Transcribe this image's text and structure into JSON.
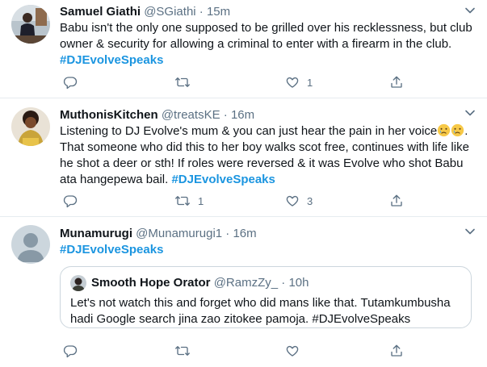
{
  "tweets": [
    {
      "name": "Samuel Giathi",
      "handle": "@SGiathi",
      "dot": "·",
      "time": "15m",
      "lines": [
        "Babu isn't the only one supposed to be grilled over his recklessness, but club",
        "owner & security for allowing a criminal to enter with a firearm in the club."
      ],
      "hashtag": "#DJEvolveSpeaks",
      "replies": "",
      "retweets": "",
      "likes": "1"
    },
    {
      "name": "MuthonisKitchen",
      "handle": "@treatsKE",
      "dot": "·",
      "time": "16m",
      "line1": "Listening to DJ Evolve's mum & you can just hear the pain in her voice",
      "emoji": [
        "crying-face",
        "crying-face"
      ],
      "line2": "That someone who did this to her boy walks scot free, continues with life like",
      "line3": "he shot a deer or sth! If roles were reversed & it was Evolve who shot Babu",
      "line4_text": "ata hangepewa bail.",
      "hashtag": "#DJEvolveSpeaks",
      "replies": "",
      "retweets": "1",
      "likes": "3"
    },
    {
      "name": "Munamurugi",
      "handle": "@Munamurugi1",
      "dot": "·",
      "time": "16m",
      "hashtag": "#DJEvolveSpeaks",
      "quote": {
        "name": "Smooth Hope Orator",
        "handle": "@RamzZy_",
        "dot": "·",
        "time": "10h",
        "lines": [
          "Let's not watch this and forget who did mans like that. Tutamkumbusha",
          "hadi Google search jina zao zitokee pamoja. #DJEvolveSpeaks"
        ]
      },
      "replies": "",
      "retweets": "",
      "likes": ""
    }
  ],
  "colors": {
    "accent": "#1b95e0",
    "muted": "#5b7083",
    "divider": "#e6ecf0"
  },
  "icons": [
    "reply-icon",
    "retweet-icon",
    "like-icon",
    "share-icon",
    "chevron-down-icon"
  ]
}
